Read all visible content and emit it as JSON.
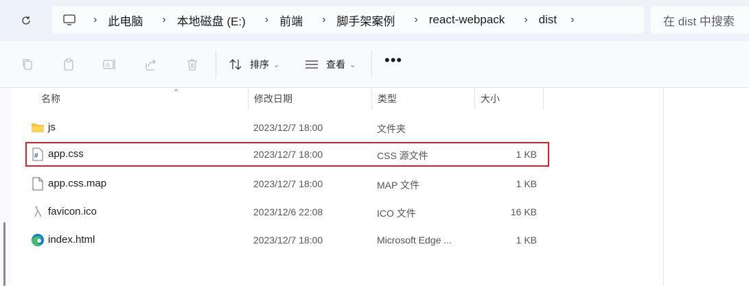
{
  "address": {
    "breadcrumbs": [
      "此电脑",
      "本地磁盘 (E:)",
      "前端",
      "脚手架案例",
      "react-webpack",
      "dist"
    ],
    "search_placeholder": "在 dist 中搜索"
  },
  "toolbar": {
    "sort_label": "排序",
    "view_label": "查看",
    "more_label": "•••"
  },
  "columns": {
    "name": "名称",
    "date": "修改日期",
    "type": "类型",
    "size": "大小"
  },
  "files": [
    {
      "name": "js",
      "date": "2023/12/7 18:00",
      "type": "文件夹",
      "size": "",
      "icon": "folder-icon"
    },
    {
      "name": "app.css",
      "date": "2023/12/7 18:00",
      "type": "CSS 源文件",
      "size": "1 KB",
      "icon": "css-file-icon",
      "highlighted": true
    },
    {
      "name": "app.css.map",
      "date": "2023/12/7 18:00",
      "type": "MAP 文件",
      "size": "1 KB",
      "icon": "blank-file-icon"
    },
    {
      "name": "favicon.ico",
      "date": "2023/12/6 22:08",
      "type": "ICO 文件",
      "size": "16 KB",
      "icon": "image-file-icon"
    },
    {
      "name": "index.html",
      "date": "2023/12/7 18:00",
      "type": "Microsoft Edge ...",
      "size": "1 KB",
      "icon": "edge-icon"
    }
  ],
  "colors": {
    "highlight_border": "#d8202a",
    "folder": "#f5c342",
    "edge_blue": "#0c7fd5",
    "edge_green": "#3fc35c"
  }
}
